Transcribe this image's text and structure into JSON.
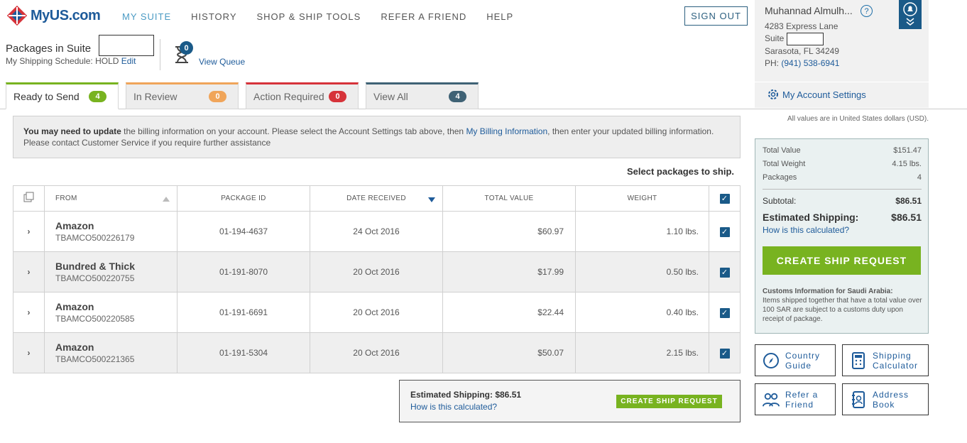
{
  "brand": {
    "name": "MyUS.com",
    "accent": "#1e5b9a",
    "green": "#78b320"
  },
  "nav": [
    {
      "label": "MY SUITE",
      "active": true
    },
    {
      "label": "HISTORY",
      "active": false
    },
    {
      "label": "SHOP & SHIP TOOLS",
      "active": false
    },
    {
      "label": "REFER A FRIEND",
      "active": false
    },
    {
      "label": "HELP",
      "active": false
    }
  ],
  "header": {
    "sign_out": "SIGN OUT"
  },
  "account": {
    "name": "Muhannad Almulh...",
    "help_icon": "question-icon",
    "street": "4283 Express Lane",
    "suite_label": "Suite",
    "city": "Sarasota, FL 34249",
    "phone_label": "PH:",
    "phone": "(941) 538-6941",
    "settings": "My Account Settings"
  },
  "packages": {
    "title": "Packages in Suite",
    "schedule_prefix": "My Shipping Schedule: HOLD",
    "edit": "Edit",
    "queue_count": "0",
    "view_queue": "View Queue"
  },
  "tabs": [
    {
      "label": "Ready to Send",
      "count": "4",
      "color": "#78b320"
    },
    {
      "label": "In Review",
      "count": "0",
      "color": "#f0a55a"
    },
    {
      "label": "Action Required",
      "count": "0",
      "color": "#d6333a"
    },
    {
      "label": "View All",
      "count": "4",
      "color": "#3f6275"
    }
  ],
  "notice": {
    "bold": "You may need to update",
    "text1": " the billing information on your account. Please select the Account Settings tab above, then ",
    "link": "My Billing Information",
    "text2": ", then enter your updated billing information. Please contact Customer Service if you require further assistance"
  },
  "select_label": "Select packages to ship.",
  "table": {
    "headers": {
      "from": "FROM",
      "package_id": "PACKAGE ID",
      "date": "DATE RECEIVED",
      "value": "TOTAL VALUE",
      "weight": "WEIGHT"
    },
    "rows": [
      {
        "from": "Amazon",
        "tracking": "TBAMCO500226179",
        "id": "01-194-4637",
        "date": "24 Oct 2016",
        "value": "$60.97",
        "weight": "1.10 lbs."
      },
      {
        "from": "Bundred & Thick",
        "tracking": "TBAMCO500220755",
        "id": "01-191-8070",
        "date": "20 Oct 2016",
        "value": "$17.99",
        "weight": "0.50 lbs."
      },
      {
        "from": "Amazon",
        "tracking": "TBAMCO500220585",
        "id": "01-191-6691",
        "date": "20 Oct 2016",
        "value": "$22.44",
        "weight": "0.40 lbs."
      },
      {
        "from": "Amazon",
        "tracking": "TBAMCO500221365",
        "id": "01-191-5304",
        "date": "20 Oct 2016",
        "value": "$50.07",
        "weight": "2.15 lbs."
      }
    ]
  },
  "bottom": {
    "estimate": "Estimated Shipping: $86.51",
    "how": "How is this calculated?",
    "button": "CREATE SHIP REQUEST"
  },
  "summary": {
    "usd_note": "All values are in United States dollars (USD).",
    "total_value_label": "Total Value",
    "total_value": "$151.47",
    "total_weight_label": "Total Weight",
    "total_weight": "4.15 lbs.",
    "packages_label": "Packages",
    "packages": "4",
    "subtotal_label": "Subtotal:",
    "subtotal": "$86.51",
    "est_label": "Estimated Shipping:",
    "est": "$86.51",
    "how": "How is this calculated?",
    "button": "CREATE SHIP REQUEST",
    "customs_title": "Customs Information for Saudi Arabia:",
    "customs_text": "Items shipped together that have a total value over 100 SAR are subject to a customs duty upon receipt of package."
  },
  "quick_links": [
    {
      "line1": "Country",
      "line2": "Guide",
      "icon": "compass-icon"
    },
    {
      "line1": "Shipping",
      "line2": "Calculator",
      "icon": "calculator-icon"
    },
    {
      "line1": "Refer a",
      "line2": "Friend",
      "icon": "people-icon"
    },
    {
      "line1": "Address",
      "line2": "Book",
      "icon": "address-book-icon"
    }
  ]
}
